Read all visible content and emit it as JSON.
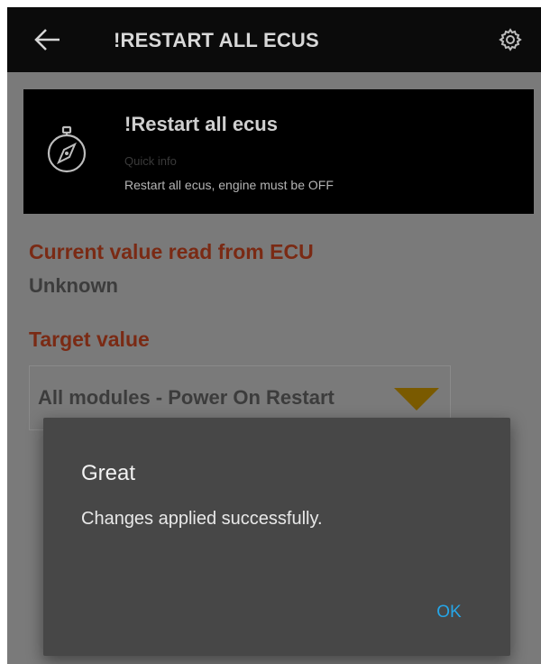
{
  "appbar": {
    "title": "!RESTART ALL ECUS",
    "back_icon": "back-arrow-icon",
    "settings_icon": "gear-icon"
  },
  "info_card": {
    "icon": "compass-icon",
    "title": "!Restart all ecus",
    "subtitle": "Quick info",
    "description": "Restart all ecus, engine must be OFF"
  },
  "current_value": {
    "label": "Current value read from ECU",
    "value": "Unknown"
  },
  "target_value": {
    "label": "Target value",
    "selected": "All modules - Power On Restart"
  },
  "dialog": {
    "title": "Great",
    "message": "Changes applied successfully.",
    "ok_label": "OK"
  },
  "colors": {
    "appbar_bg": "#0b0b0b",
    "scrim_bg": "#7a7a7a",
    "section_label": "#7a2a14",
    "dropdown_arrow": "#7a5a00",
    "dialog_bg": "#474747",
    "ok_accent": "#26a6e8"
  }
}
